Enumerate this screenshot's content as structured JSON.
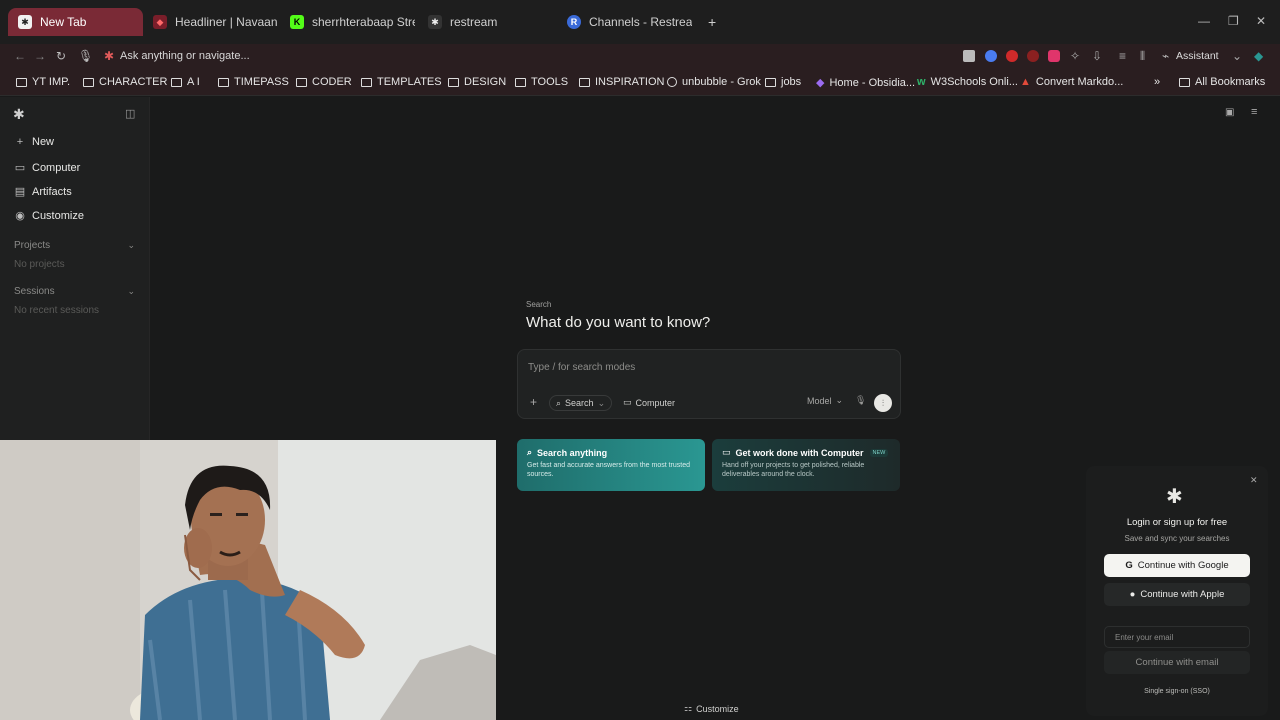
{
  "browser": {
    "tabs": [
      {
        "title": "New Tab",
        "icon": "perplexity-icon",
        "active": true
      },
      {
        "title": "Headliner | Navaan Sandh",
        "icon": "headliner-icon",
        "active": false
      },
      {
        "title": "sherrhterabaap Stream - ",
        "icon": "kick-icon",
        "active": false
      },
      {
        "title": "restream",
        "icon": "perplexity-icon",
        "active": false
      },
      {
        "title": "Channels - Restream",
        "icon": "restream-icon",
        "active": false
      }
    ],
    "new_tab_symbol": "+",
    "omnibox_placeholder": "Ask anything or navigate...",
    "assistant_label": "Assistant",
    "bookmarks": [
      {
        "label": "YT IMP.",
        "icon": "folder-icon"
      },
      {
        "label": "CHARACTER",
        "icon": "folder-icon"
      },
      {
        "label": "A I",
        "icon": "folder-icon"
      },
      {
        "label": "TIMEPASS",
        "icon": "folder-icon"
      },
      {
        "label": "CODER",
        "icon": "folder-icon"
      },
      {
        "label": "TEMPLATES",
        "icon": "folder-icon"
      },
      {
        "label": "DESIGN",
        "icon": "folder-icon"
      },
      {
        "label": "TOOLS",
        "icon": "folder-icon"
      },
      {
        "label": "INSPIRATION",
        "icon": "folder-icon"
      },
      {
        "label": "unbubble - Grok",
        "icon": "grok-icon"
      },
      {
        "label": "jobs",
        "icon": "folder-icon"
      },
      {
        "label": "Home - Obsidia...",
        "icon": "obsidian-icon"
      },
      {
        "label": "W3Schools Onli...",
        "icon": "w3schools-icon"
      },
      {
        "label": "Convert Markdo...",
        "icon": "convert-icon"
      }
    ],
    "more_bookmarks": "»",
    "all_bookmarks": "All Bookmarks"
  },
  "sidebar": {
    "nav": [
      {
        "label": "New",
        "icon": "plus-icon"
      },
      {
        "label": "Computer",
        "icon": "computer-icon"
      },
      {
        "label": "Artifacts",
        "icon": "artifacts-icon"
      },
      {
        "label": "Customize",
        "icon": "customize-icon"
      }
    ],
    "projects_label": "Projects",
    "projects_empty": "No projects",
    "sessions_label": "Sessions",
    "sessions_empty": "No recent sessions"
  },
  "main": {
    "mode_label": "Search",
    "heading": "What do you want to know?",
    "input_placeholder": "Type / for search modes",
    "search_mode": "Search",
    "computer_mode": "Computer",
    "model_label": "Model",
    "cards": [
      {
        "title": "Search anything",
        "desc": "Get fast and accurate answers from the most trusted sources.",
        "badge": ""
      },
      {
        "title": "Get work done with Computer",
        "desc": "Hand off your projects to get polished, reliable deliverables around the clock.",
        "badge": "NEW"
      }
    ],
    "customize_label": "Customize"
  },
  "login": {
    "title": "Login or sign up for free",
    "subtitle": "Save and sync your searches",
    "google": "Continue with Google",
    "apple": "Continue with Apple",
    "email_placeholder": "Enter your email",
    "email_button": "Continue with email",
    "sso": "Single sign-on (SSO)"
  },
  "colors": {
    "accent_teal": "#2a9792",
    "tab_active": "#7a2a36",
    "background": "#191a1a"
  }
}
